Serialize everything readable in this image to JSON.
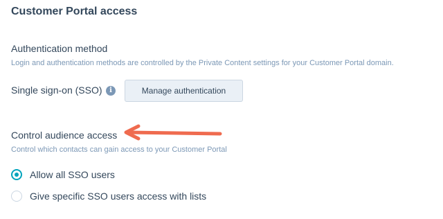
{
  "section": {
    "title": "Customer Portal access"
  },
  "authentication": {
    "heading": "Authentication method",
    "help_text": "Login and authentication methods are controlled by the Private Content settings for your Customer Portal domain.",
    "sso_label": "Single sign-on (SSO)",
    "info_icon": "info-icon",
    "info_glyph": "i",
    "manage_button_label": "Manage authentication"
  },
  "audience": {
    "heading": "Control audience access",
    "help_text": "Control which contacts can gain access to your Customer Portal",
    "options": [
      {
        "label": "Allow all SSO users",
        "selected": true
      },
      {
        "label": "Give specific SSO users access with lists",
        "selected": false
      }
    ]
  },
  "annotation": {
    "arrow_color": "#ef6b4f"
  },
  "colors": {
    "text": "#33475b",
    "muted": "#7c98b6",
    "accent": "#00a4bd",
    "button_bg": "#eaf0f6",
    "button_border": "#cbd6e2"
  }
}
